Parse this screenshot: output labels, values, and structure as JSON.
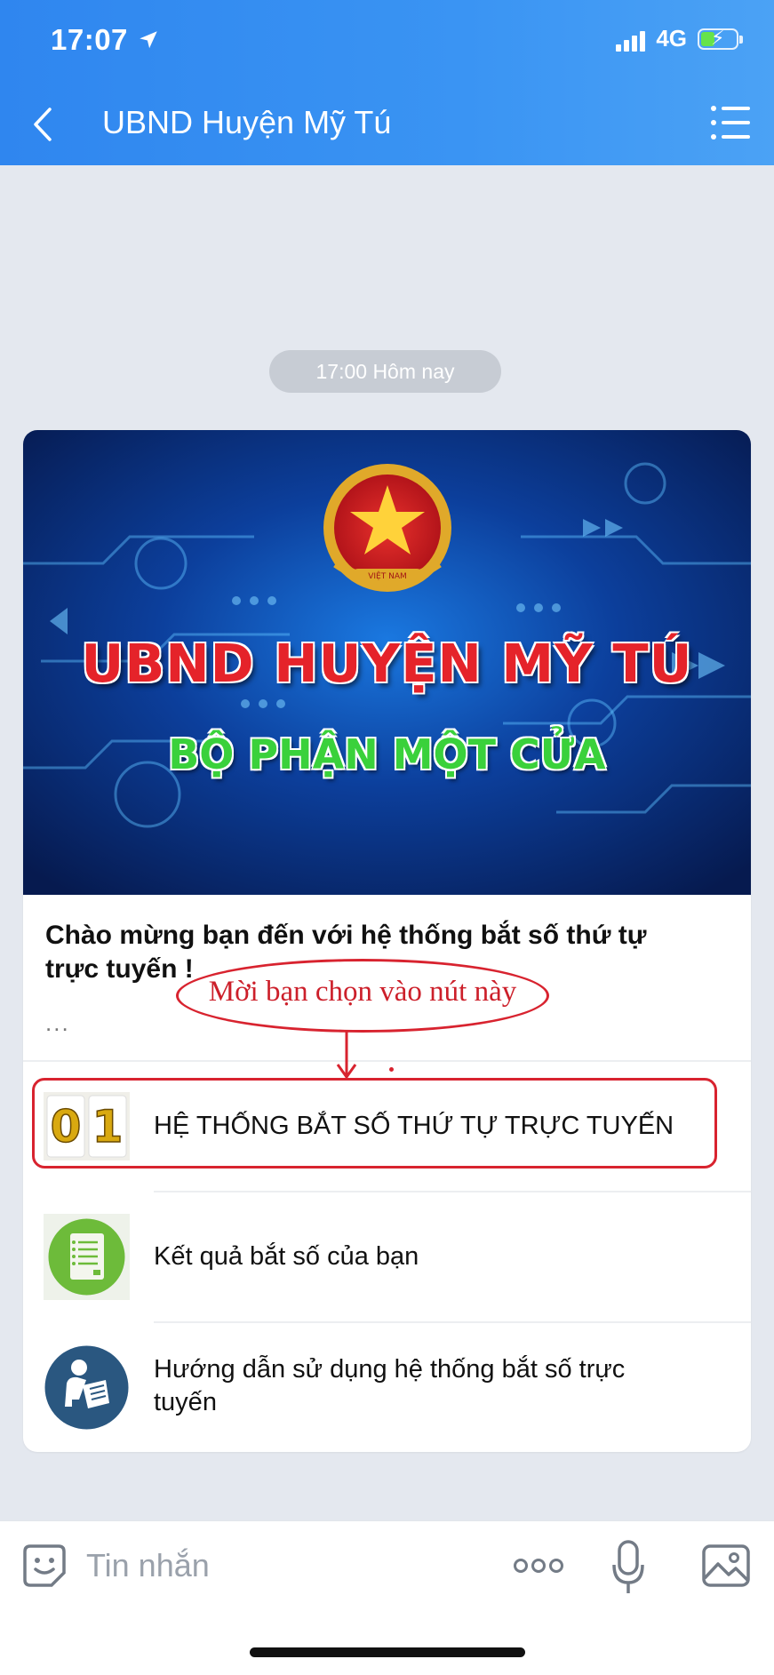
{
  "status_bar": {
    "time": "17:07",
    "network": "4G"
  },
  "header": {
    "title": "UBND Huyện Mỹ Tú"
  },
  "chat": {
    "timestamp": "17:00 Hôm nay"
  },
  "card": {
    "banner_title": "UBND HUYỆN MỸ TÚ",
    "banner_subtitle": "BỘ PHẬN MỘT CỬA",
    "seal_text": "VIỆT NAM",
    "welcome_text": "Chào mừng bạn đến với hệ thống bắt số thứ tự trực tuyến !",
    "ellipsis": "...",
    "items": [
      {
        "label": "HỆ THỐNG BẮT SỐ THỨ TỰ TRỰC TUYẾN",
        "icon": "number-01-icon",
        "icon_digits": [
          "0",
          "1"
        ]
      },
      {
        "label": "Kết quả bắt số của bạn",
        "icon": "results-list-icon"
      },
      {
        "label": "Hướng dẫn sử dụng hệ thống bắt số trực tuyến",
        "icon": "user-guide-icon"
      }
    ]
  },
  "annotation": {
    "text": "Mời bạn chọn vào nút này",
    "color": "#d8232f"
  },
  "input_bar": {
    "placeholder": "Tin nhắn"
  },
  "colors": {
    "header": "#3a94f3",
    "background": "#e4e8ef",
    "accent_red": "#e5232a",
    "accent_green": "#3ad13b"
  }
}
